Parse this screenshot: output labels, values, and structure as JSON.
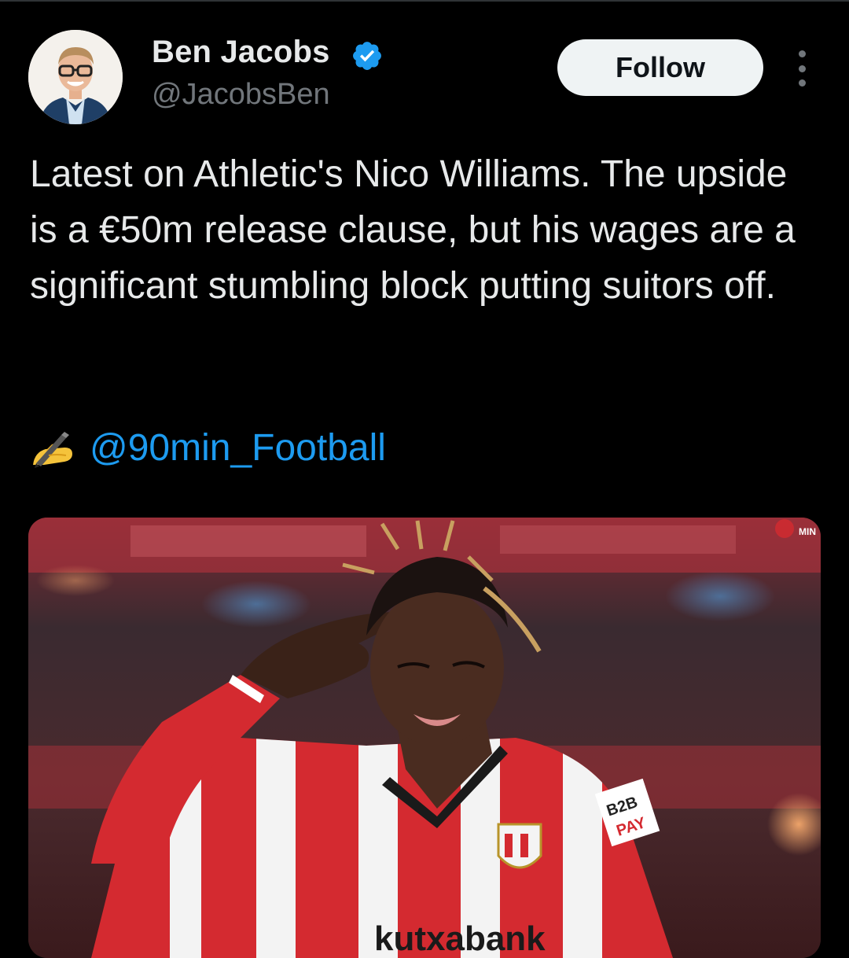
{
  "author": {
    "name": "Ben Jacobs",
    "handle": "@JacobsBen",
    "verified": true,
    "avatar_icon": "profile-photo"
  },
  "actions": {
    "follow_label": "Follow",
    "more_icon": "more-vertical-icon"
  },
  "tweet": {
    "text": "Latest on Athletic's Nico Williams. The upside is a €50m release clause, but his wages are a significant stumbling block putting suitors off.",
    "emoji": "✍️",
    "mention": "@90min_Football"
  },
  "media": {
    "jersey_sponsor_sleeve": "B2B PAY",
    "jersey_chest_text": "kutxabank",
    "watermark": "90 MIN"
  },
  "colors": {
    "background": "#000000",
    "text": "#e7e9ea",
    "secondary": "#71767b",
    "link": "#1d9bf0",
    "verified": "#1d9bf0",
    "follow_bg": "#eff3f4"
  }
}
